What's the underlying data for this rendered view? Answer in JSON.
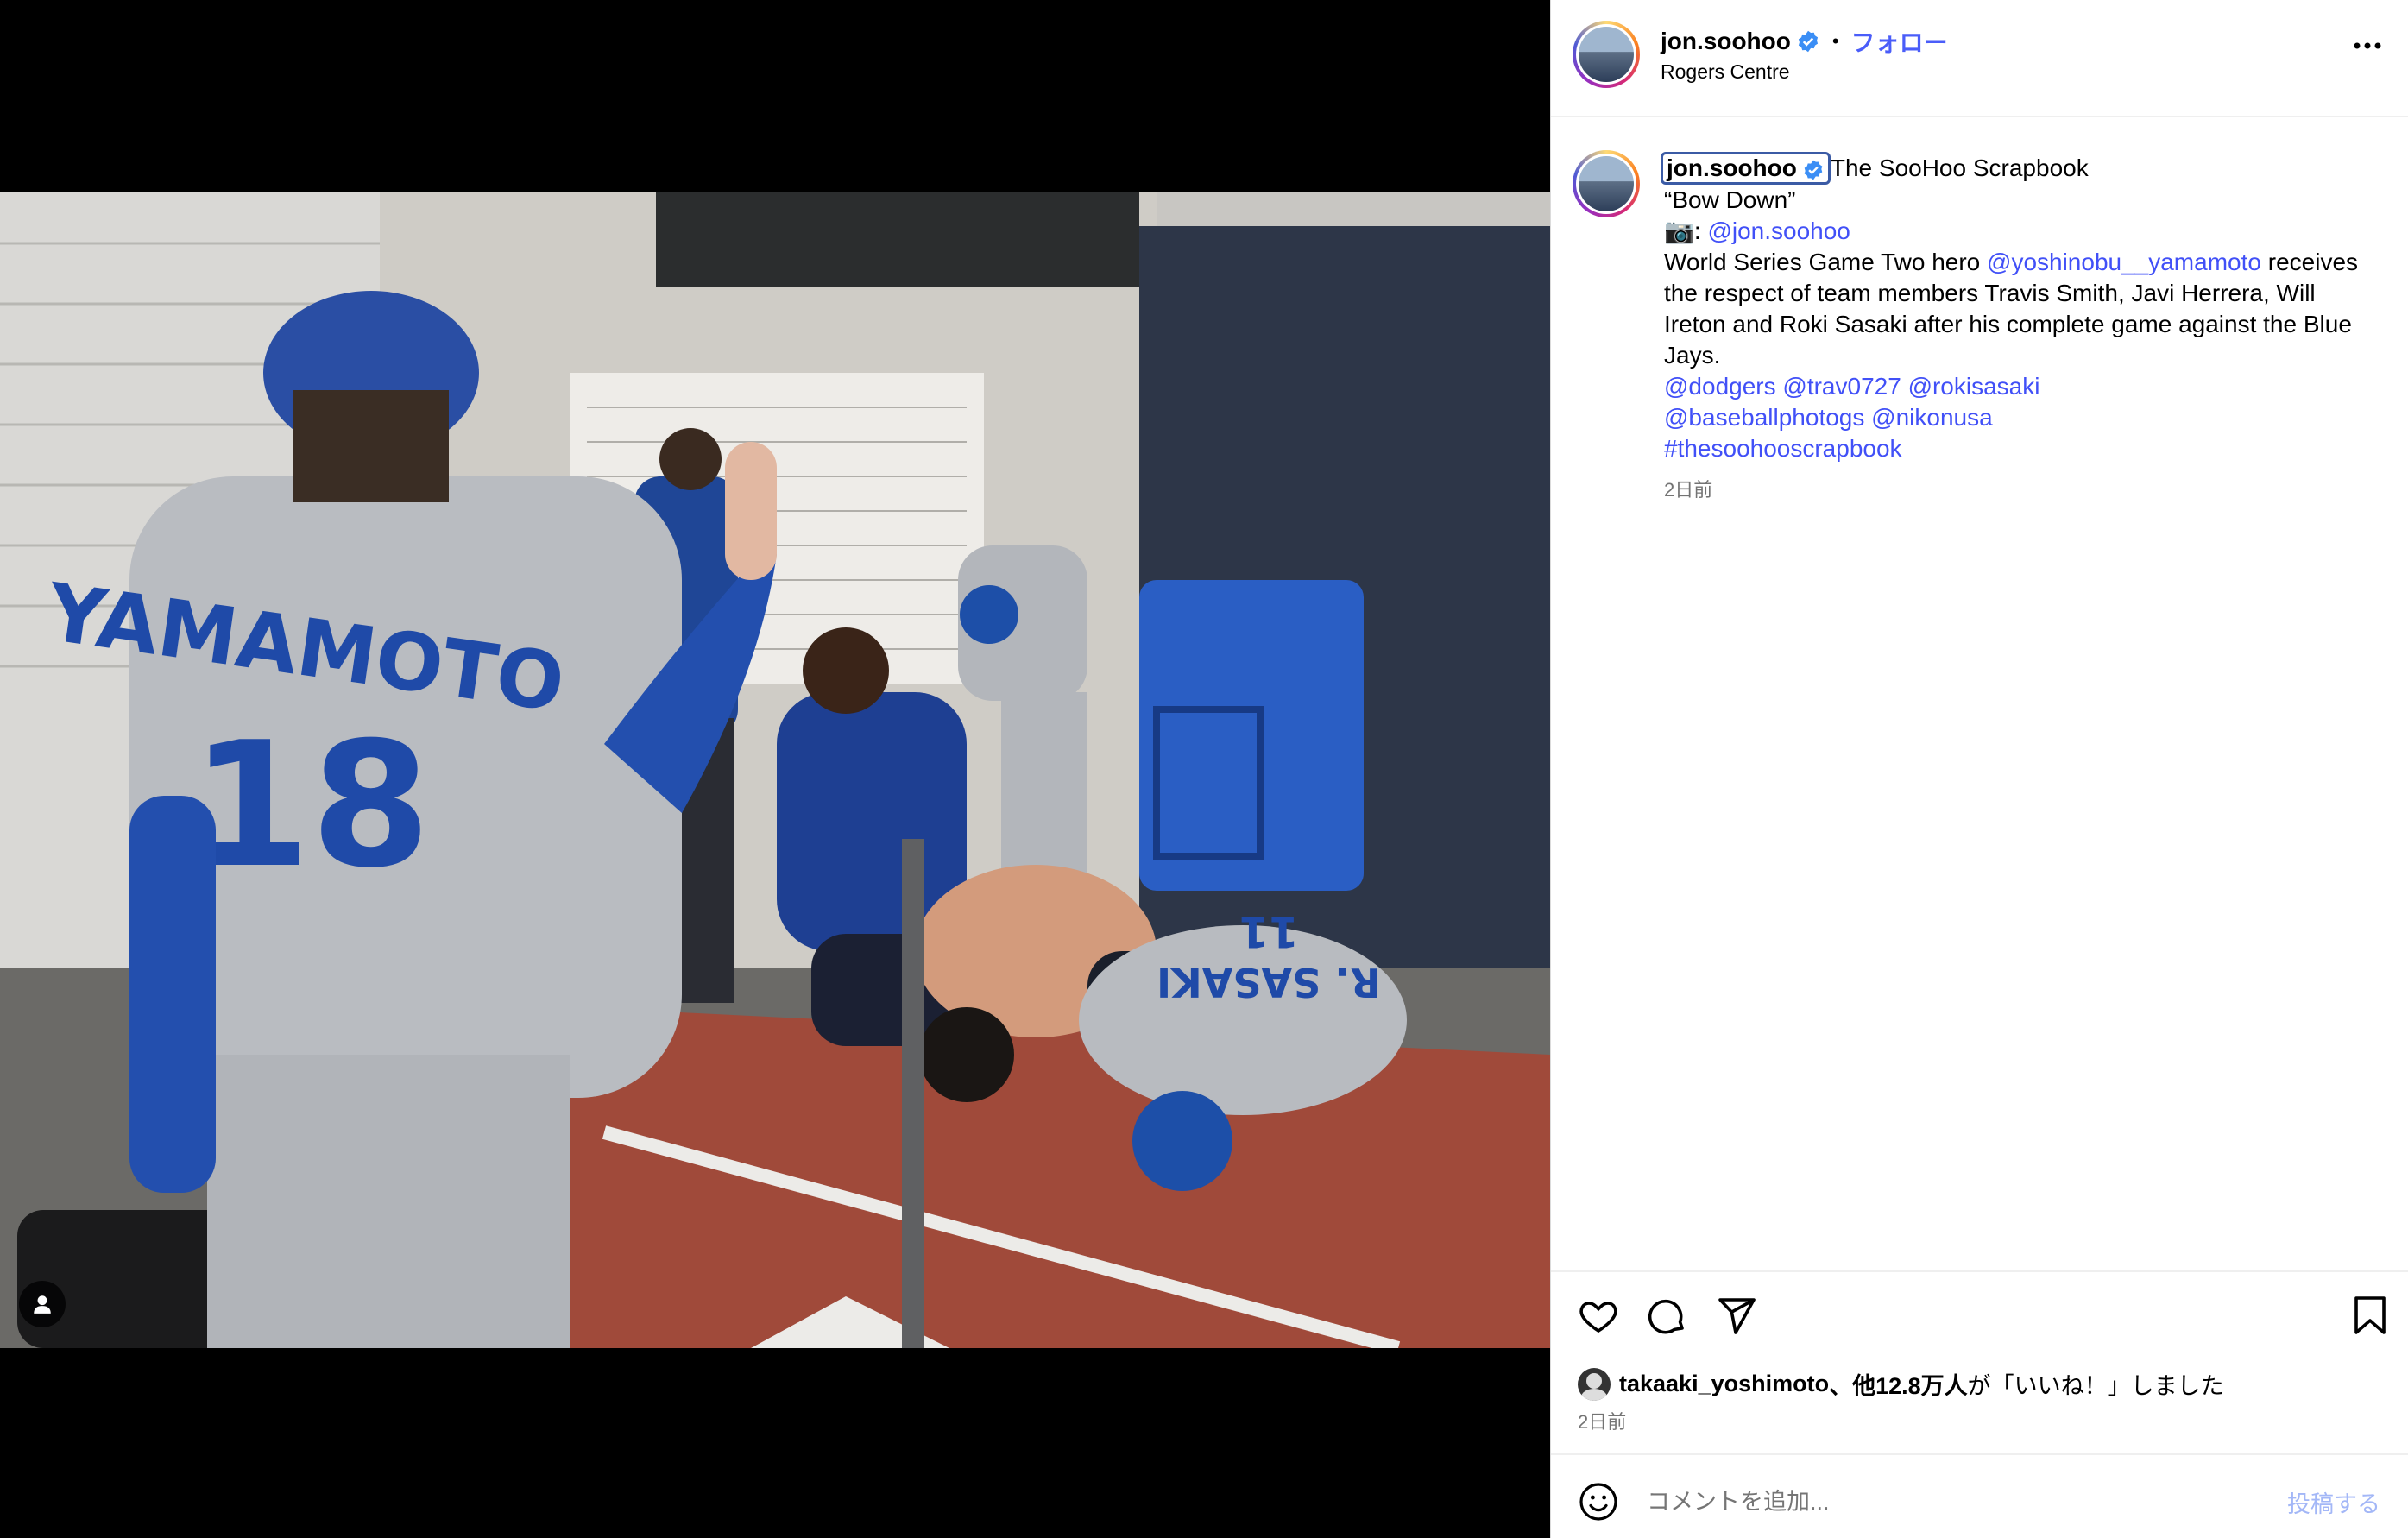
{
  "post": {
    "username": "jon.soohoo",
    "separator": "•",
    "follow_label": "フォロー",
    "location": "Rogers Centre",
    "more_icon": "more-horizontal-icon"
  },
  "caption": {
    "username": "jon.soohoo",
    "title": "The SooHoo Scrapbook",
    "quote": "“Bow Down”",
    "camera_prefix": "📷:",
    "camera_mention": "@jon.soohoo",
    "text_part1": "World Series Game Two hero",
    "mention_yamamoto": "@yoshinobu__yamamoto",
    "text_part2": "receives the respect of team members Travis Smith, Javi Herrera, Will Ireton and Roki Sasaki after his complete game against the Blue Jays.",
    "tags_line1": [
      "@dodgers",
      "@trav0727",
      "@rokisasaki"
    ],
    "tags_line2": [
      "@baseballphotogs",
      "@nikonusa"
    ],
    "hashtag": "#thesoohooscrapbook",
    "time": "2日前"
  },
  "photo": {
    "jersey_name": "YAMAMOTO",
    "jersey_number": "18",
    "sasaki_name": "R. SASAKI",
    "sasaki_number": "11"
  },
  "likes": {
    "user": "takaaki_yoshimoto",
    "rest_bold": "、他12.8万人",
    "rest": "が「いいね！」しました",
    "time": "2日前"
  },
  "comment": {
    "placeholder": "コメントを追加...",
    "post_label": "投稿する"
  },
  "colors": {
    "accent": "#4a5df9",
    "mention": "#4150f7",
    "dodger_blue": "#1f4aa8"
  }
}
